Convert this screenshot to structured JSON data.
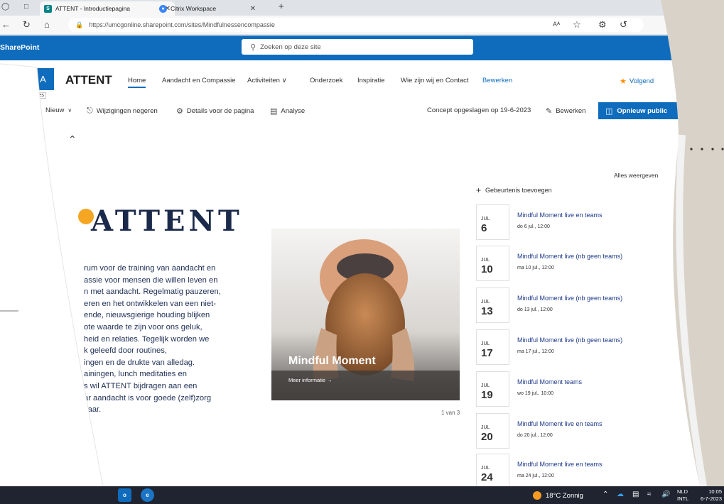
{
  "browser": {
    "tabs": [
      {
        "label": "ATTENT - Introductiepagina",
        "active": true,
        "favicon_color": "#038387"
      },
      {
        "label": "Citrix Workspace",
        "active": false,
        "favicon_color": "#3b86f7"
      }
    ],
    "new_tab": "+",
    "url": "https://umcgonline.sharepoint.com/sites/Mindfulnessencompassie",
    "reader": "Aᴬ"
  },
  "suite": {
    "title": "SharePoint",
    "search_placeholder": "Zoeken op deze site",
    "brand_color": "#0f6cbd"
  },
  "site": {
    "logo_letter": "A",
    "sites_tooltip": "ites",
    "name": "ATTENT",
    "nav": [
      {
        "label": "Home"
      },
      {
        "label": "Aandacht en Compassie"
      },
      {
        "label": "Activiteiten ∨"
      },
      {
        "label": "Onderzoek"
      },
      {
        "label": "Inspiratie"
      },
      {
        "label": "Wie zijn wij en Contact"
      },
      {
        "label": "Bewerken"
      }
    ],
    "follow": "Volgend"
  },
  "commands": {
    "new": "Nieuw",
    "discard": "Wijzigingen negeren",
    "details": "Details voor de pagina",
    "analytics": "Analyse",
    "saved": "Concept opgeslagen op 19-6-2023",
    "edit": "Bewerken",
    "publish": "Opnieuw public"
  },
  "content": {
    "heading": "ATTENT",
    "intro_lines": [
      "rum voor de training van aandacht en",
      "assie voor mensen die willen leven en",
      "n met aandacht. Regelmatig pauzeren,",
      "eren en het ontwikkelen van een niet-",
      "ende, nieuwsgierige houding blijken",
      "ote waarde te zijn voor ons geluk,",
      "heid en relaties. Tegelijk worden we",
      "k        geleefd        door        routines,",
      "ingen en de drukte van alledag.",
      "ainingen,   lunch   meditaties   en",
      "s wil ATTENT bijdragen aan een",
      "ar aandacht is voor goede (zelf)zorg",
      "kaar."
    ],
    "hero": {
      "title": "Mindful Moment",
      "link": "Meer informatie →",
      "pager": "1 van 3"
    }
  },
  "events": {
    "see_all": "Alles weergeven",
    "add": "Gebeurtenis toevoegen",
    "items": [
      {
        "month": "JUL",
        "day": "6",
        "title": "Mindful Moment live en teams",
        "time": "do 6 jul., 12:00"
      },
      {
        "month": "JUL",
        "day": "10",
        "title": "Mindful Moment live (nb geen teams)",
        "time": "ma 10 jul., 12:00"
      },
      {
        "month": "JUL",
        "day": "13",
        "title": "Mindful Moment live (nb geen teams)",
        "time": "do 13 jul., 12:00"
      },
      {
        "month": "JUL",
        "day": "17",
        "title": "Mindful Moment live (nb geen teams)",
        "time": "ma 17 jul., 12:00"
      },
      {
        "month": "JUL",
        "day": "19",
        "title": "Mindful Moment teams",
        "time": "wo 19 jul., 10:00"
      },
      {
        "month": "JUL",
        "day": "20",
        "title": "Mindful Moment live en teams",
        "time": "do 20 jul., 12:00"
      },
      {
        "month": "JUL",
        "day": "24",
        "title": "Mindful Moment  live en teams",
        "time": "ma 24 jul., 12:00"
      }
    ]
  },
  "taskbar": {
    "weather": "18°C Zonnig",
    "lang_top": "NLD",
    "lang_bottom": "INTL",
    "time": "10:05",
    "date": "6-7-2023"
  }
}
